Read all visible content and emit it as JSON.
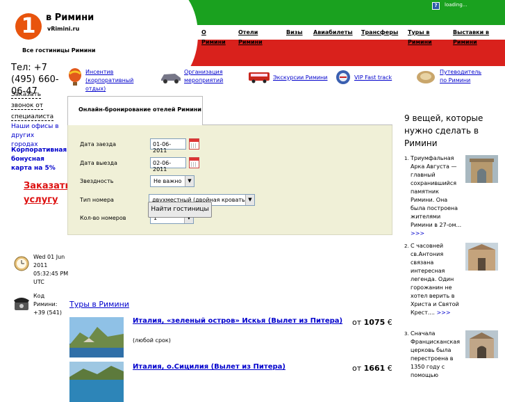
{
  "header": {
    "logo_number": "1",
    "logo_title": "в Римини",
    "logo_sub": "vRimini.ru",
    "all_hotels": "Все гостиницы Римини",
    "loading": "loading..."
  },
  "nav": [
    {
      "label": "О Римини"
    },
    {
      "label": "Отели Римини"
    },
    {
      "label": "Визы"
    },
    {
      "label": "Авиабилеты"
    },
    {
      "label": "Трансферы"
    },
    {
      "label": "Туры в Римини"
    },
    {
      "label": "Выставки в Римини"
    }
  ],
  "services": [
    {
      "label": "Инсентив (корпоративный отдых)",
      "icon": "balloon-icon"
    },
    {
      "label": "Организация мероприятий",
      "icon": "car-icon"
    },
    {
      "label": "Экскурсии Римини",
      "icon": "bus-icon"
    },
    {
      "label": "VIP Fast track",
      "icon": "vip-icon"
    },
    {
      "label": "Путеводитель по Римини",
      "icon": "book-icon"
    }
  ],
  "sidebar": {
    "phone": "Тел: +7 (495) 660-06-47",
    "callback": "Заказать звонок от специалиста",
    "offices": "Наши офисы в других городах",
    "corporate": "Корпоративная бонусная карта на 5%",
    "order": "Заказать услугу",
    "datetime": "Wed 01 Jun 2011 05:32:45 PM UTC",
    "code": "Код Римини: +39 (541)"
  },
  "booking": {
    "tab": "Онлайн-бронирование отелей Римини",
    "checkin_label": "Дата заезда",
    "checkin_value": "01-06-2011",
    "checkout_label": "Дата выезда",
    "checkout_value": "02-06-2011",
    "stars_label": "Звездность",
    "stars_value": "Не важно",
    "room_label": "Тип номера",
    "room_value": "двухместный (двойная кровать)",
    "rooms_label": "Кол-во номеров",
    "rooms_value": "1",
    "find_button": "Найти гостиницы"
  },
  "right": {
    "title": "9 вещей, которые нужно сделать в Римини",
    "facts": [
      {
        "num": "1.",
        "text": "Триумфальная Арка Августа — главный сохранившийся памятник Римини. Она была построена жителями Римини в 27-ом...",
        "more": ">>>"
      },
      {
        "num": "2.",
        "text": "С часовней св.Антония связана интересная легенда. Один горожанин не хотел верить в Христа и Святой Крест....",
        "more": ">>>"
      },
      {
        "num": "3.",
        "text": "Сначала Францисканская церковь была перестроена в 1350 году с помощью",
        "more": ""
      }
    ]
  },
  "tours": {
    "title": "Туры в Римини",
    "items": [
      {
        "name": "Италия, «зеленый остров» Искья (Вылет из Питера)",
        "note": "(любой срок)",
        "price_prefix": "от",
        "price": "1075",
        "currency": "€"
      },
      {
        "name": "Италия, о.Сицилия (Вылет из Питера)",
        "note": "",
        "price_prefix": "от",
        "price": "1661",
        "currency": "€"
      }
    ]
  }
}
